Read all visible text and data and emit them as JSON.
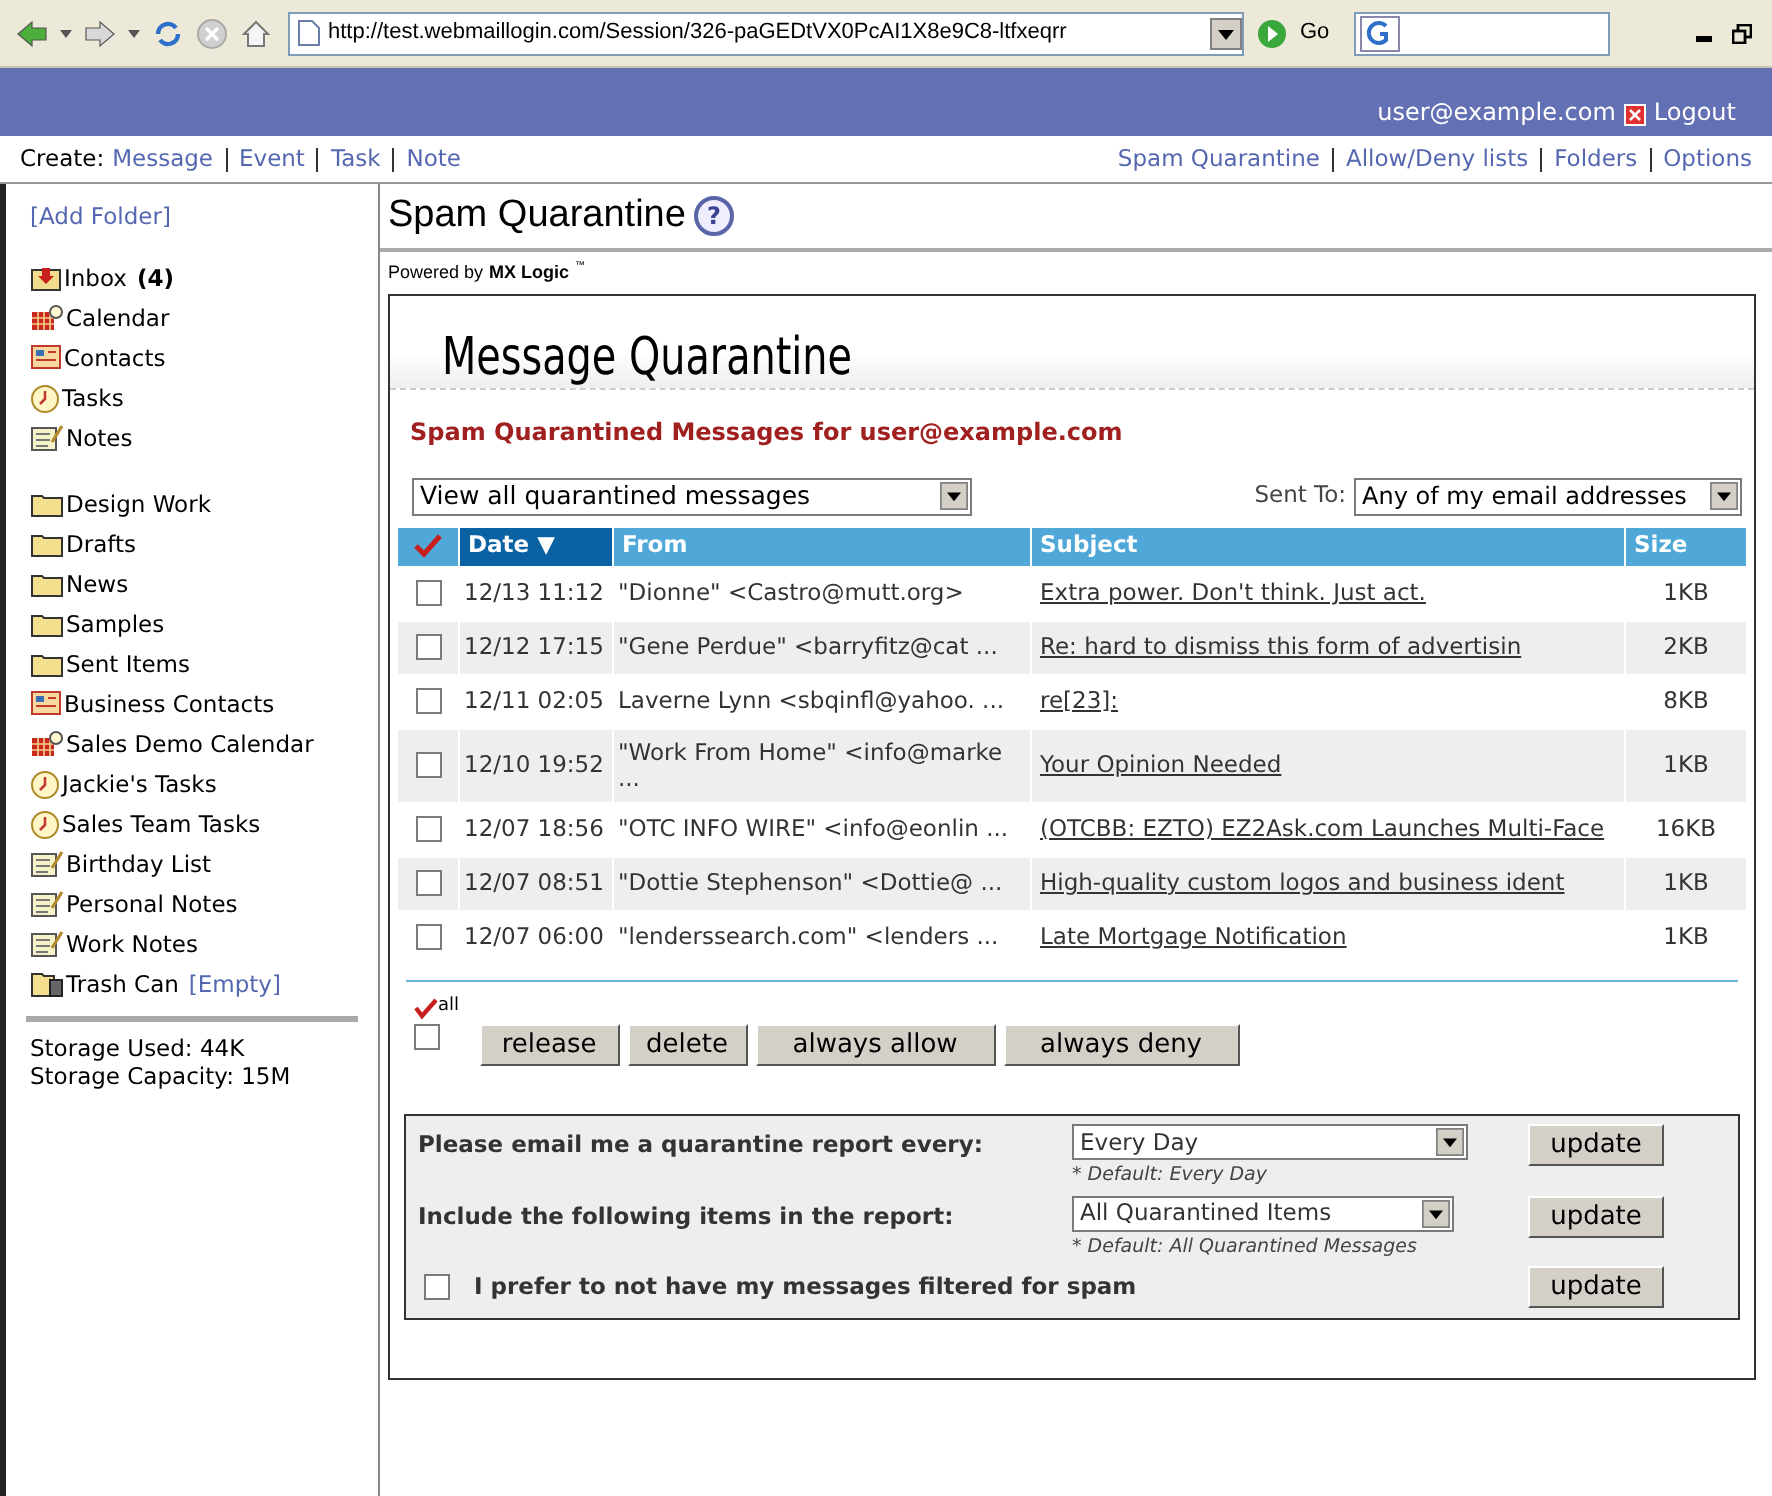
{
  "browser": {
    "address": "http://test.webmaillogin.com/Session/326-paGEDtVX0PcAI1X8e9C8-ltfxeqrr",
    "go_label": "Go"
  },
  "header": {
    "user": "user@example.com",
    "logout": "Logout"
  },
  "create": {
    "label": "Create:",
    "links": [
      "Message",
      "Event",
      "Task",
      "Note"
    ]
  },
  "nav_links": [
    "Spam Quarantine",
    "Allow/Deny lists",
    "Folders",
    "Options"
  ],
  "sidebar": {
    "add_folder": "[Add Folder]",
    "items": [
      {
        "kind": "inbox",
        "label": "Inbox",
        "count": "(4)"
      },
      {
        "kind": "calendar",
        "label": "Calendar"
      },
      {
        "kind": "contacts",
        "label": "Contacts"
      },
      {
        "kind": "tasks",
        "label": "Tasks"
      },
      {
        "kind": "notes",
        "label": "Notes"
      },
      {
        "kind": "gap"
      },
      {
        "kind": "folder",
        "label": "Design Work"
      },
      {
        "kind": "folder",
        "label": "Drafts"
      },
      {
        "kind": "folder",
        "label": "News"
      },
      {
        "kind": "folder",
        "label": "Samples"
      },
      {
        "kind": "folder",
        "label": "Sent Items"
      },
      {
        "kind": "contacts",
        "label": "Business Contacts"
      },
      {
        "kind": "calendar",
        "label": "Sales Demo Calendar"
      },
      {
        "kind": "tasks",
        "label": "Jackie's Tasks"
      },
      {
        "kind": "tasks",
        "label": "Sales Team Tasks"
      },
      {
        "kind": "notes",
        "label": "Birthday List"
      },
      {
        "kind": "notes",
        "label": "Personal Notes"
      },
      {
        "kind": "notes",
        "label": "Work Notes"
      },
      {
        "kind": "trash",
        "label": "Trash Can",
        "action": "[Empty]"
      }
    ],
    "storage": [
      "Storage Used: 44K",
      "Storage Capacity: 15M"
    ]
  },
  "page": {
    "title": "Spam Quarantine",
    "help": "?",
    "powered_by": "Powered by",
    "brand": "MX Logic",
    "brand_mark": "™"
  },
  "quarantine": {
    "title": "Message Quarantine",
    "heading": "Spam Quarantined Messages for user@example.com",
    "view_select": "View all quarantined messages",
    "sent_to_label": "Sent To:",
    "sent_to_select": "Any of my email addresses",
    "columns": [
      {
        "label": "Date ▼",
        "sorted": true
      },
      {
        "label": "From",
        "sorted": false
      },
      {
        "label": "Subject",
        "sorted": false
      },
      {
        "label": "Size",
        "sorted": false
      }
    ],
    "rows": [
      {
        "checked": false,
        "date": "12/13 11:12",
        "from": "\"Dionne\" <Castro@mutt.org>",
        "subject": "Extra power. Don't think. Just act.",
        "size": "1KB"
      },
      {
        "checked": false,
        "date": "12/12 17:15",
        "from": "\"Gene Perdue\" <barryfitz@cat ...",
        "subject": "Re: hard to dismiss this form of advertisin",
        "size": "2KB"
      },
      {
        "checked": false,
        "date": "12/11 02:05",
        "from": "Laverne Lynn <sbqinfl@yahoo. ...",
        "subject": "re[23]:",
        "size": "8KB"
      },
      {
        "checked": false,
        "date": "12/10 19:52",
        "from": "\"Work From Home\" <info@marke ...",
        "subject": "Your Opinion Needed",
        "size": "1KB"
      },
      {
        "checked": false,
        "date": "12/07 18:56",
        "from": "\"OTC INFO WIRE\" <info@eonlin ...",
        "subject": "(OTCBB: EZTO) EZ2Ask.com Launches Multi-Face",
        "size": "16KB"
      },
      {
        "checked": false,
        "date": "12/07 08:51",
        "from": "\"Dottie Stephenson\" <Dottie@ ...",
        "subject": "High-quality custom logos and business ident",
        "size": "1KB"
      },
      {
        "checked": false,
        "date": "12/07 06:00",
        "from": "\"lenderssearch.com\" <lenders ...",
        "subject": "Late Mortgage Notification",
        "size": "1KB"
      }
    ],
    "all_label": "all",
    "all_checked": false,
    "actions": [
      "release",
      "delete",
      "always allow",
      "always deny"
    ]
  },
  "settings": [
    {
      "kind": "select",
      "label": "Please email me a quarantine report every:",
      "value": "Every Day",
      "hint": "* Default: Every Day",
      "button": "update"
    },
    {
      "kind": "select",
      "label": "Include the following items in the report:",
      "value": "All Quarantined Items",
      "hint": "* Default: All Quarantined Messages",
      "button": "update"
    },
    {
      "kind": "checkbox",
      "label": "I prefer to not have my messages filtered for spam",
      "checked": false,
      "button": "update"
    }
  ]
}
